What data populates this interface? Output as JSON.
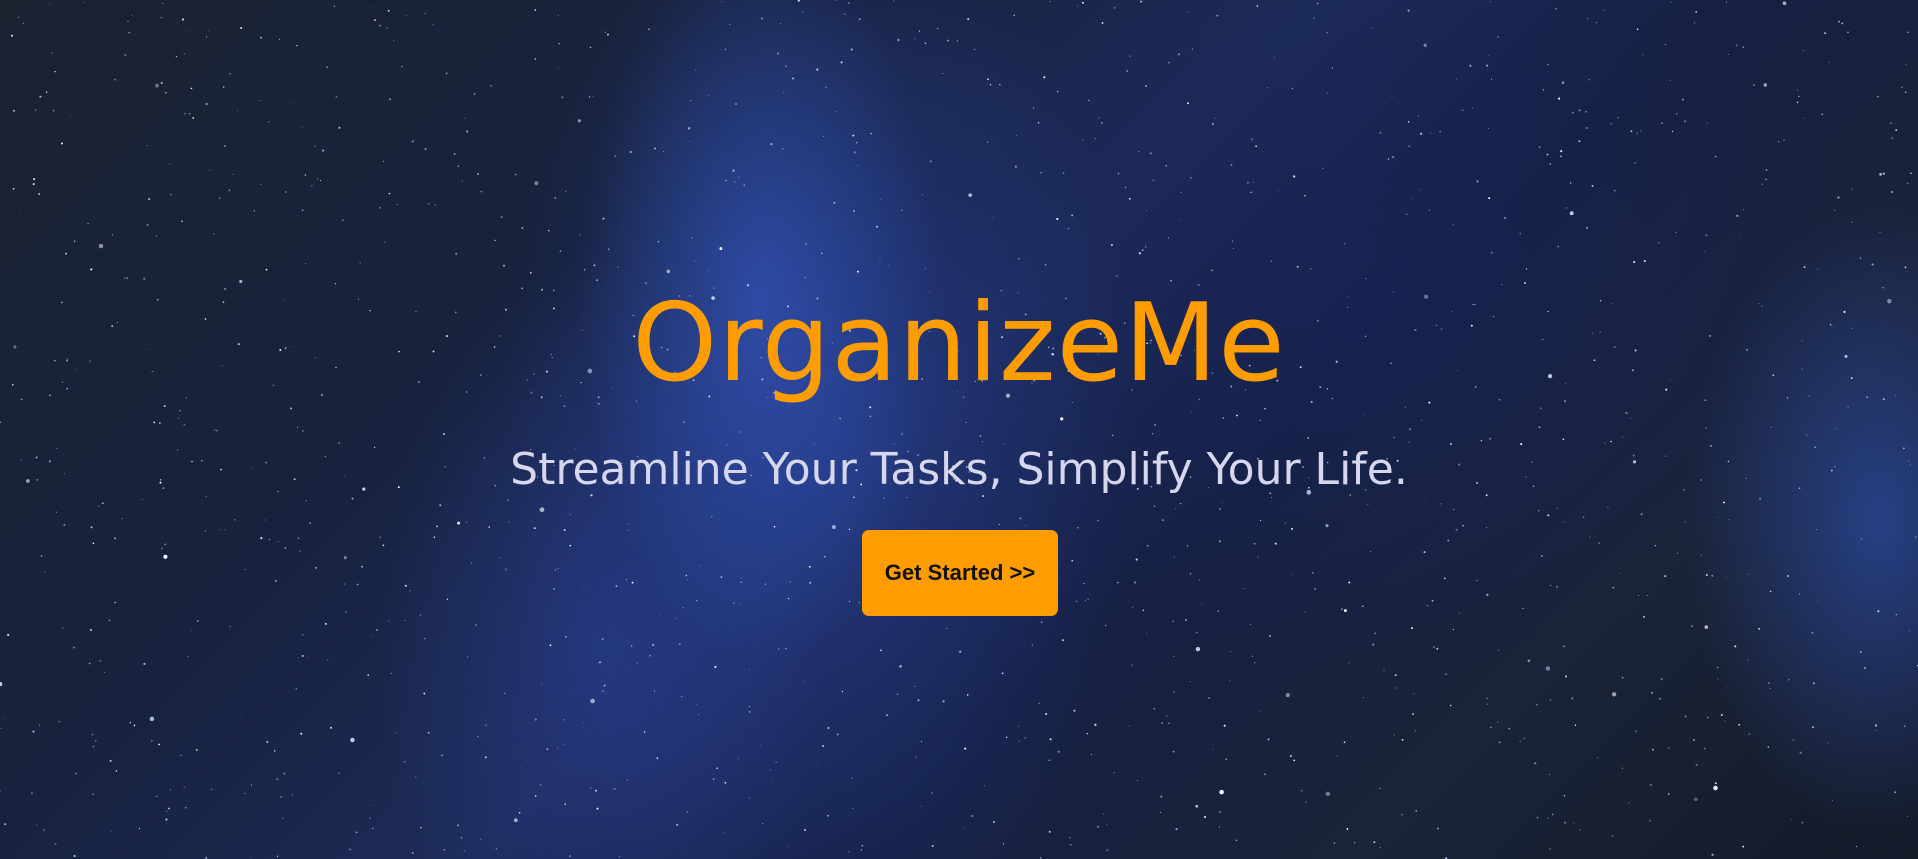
{
  "hero": {
    "title": "OrganizeMe",
    "tagline": "Streamline Your Tasks, Simplify Your Life.",
    "cta_label": "Get Started >>"
  },
  "colors": {
    "accent": "#ff9c00",
    "tagline": "#d6d6ec",
    "button_text": "#111111",
    "background": "#1f2022"
  },
  "background": {
    "type": "starfield-image",
    "description_icon": "milky-way-night-sky"
  }
}
